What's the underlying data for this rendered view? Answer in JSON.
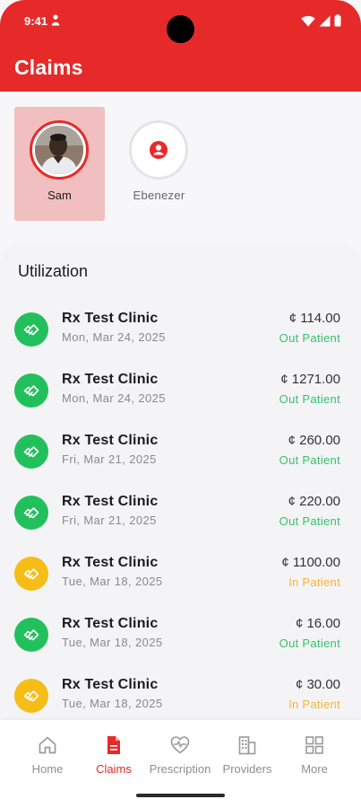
{
  "status_bar": {
    "time": "9:41"
  },
  "header": {
    "title": "Claims",
    "bg_color": "#e62a2a"
  },
  "profiles": [
    {
      "name": "Sam",
      "selected": true
    },
    {
      "name": "Ebenezer",
      "selected": false
    }
  ],
  "utilization": {
    "title": "Utilization",
    "items": [
      {
        "clinic": "Rx Test Clinic",
        "date": "Mon, Mar 24, 2025",
        "amount": "¢ 114.00",
        "type": "Out Patient",
        "status_color": "#22c05c"
      },
      {
        "clinic": "Rx Test Clinic",
        "date": "Mon, Mar 24, 2025",
        "amount": "¢ 1271.00",
        "type": "Out Patient",
        "status_color": "#22c05c"
      },
      {
        "clinic": "Rx Test Clinic",
        "date": "Fri, Mar 21, 2025",
        "amount": "¢ 260.00",
        "type": "Out Patient",
        "status_color": "#22c05c"
      },
      {
        "clinic": "Rx Test Clinic",
        "date": "Fri, Mar 21, 2025",
        "amount": "¢ 220.00",
        "type": "Out Patient",
        "status_color": "#22c05c"
      },
      {
        "clinic": "Rx Test Clinic",
        "date": "Tue, Mar 18, 2025",
        "amount": "¢ 1100.00",
        "type": "In Patient",
        "status_color": "#f5bd16"
      },
      {
        "clinic": "Rx Test Clinic",
        "date": "Tue, Mar 18, 2025",
        "amount": "¢ 16.00",
        "type": "Out Patient",
        "status_color": "#22c05c"
      },
      {
        "clinic": "Rx Test Clinic",
        "date": "Tue, Mar 18, 2025",
        "amount": "¢ 30.00",
        "type": "In Patient",
        "status_color": "#f5bd16"
      }
    ],
    "type_colors": {
      "Out Patient": "#37c26b",
      "In Patient": "#f6b43a"
    }
  },
  "bottom_nav": {
    "items": [
      {
        "label": "Home",
        "icon": "home-icon",
        "active": false
      },
      {
        "label": "Claims",
        "icon": "claims-document-icon",
        "active": true
      },
      {
        "label": "Prescription",
        "icon": "heart-pulse-icon",
        "active": false
      },
      {
        "label": "Providers",
        "icon": "building-icon",
        "active": false
      },
      {
        "label": "More",
        "icon": "grid-icon",
        "active": false
      }
    ]
  }
}
